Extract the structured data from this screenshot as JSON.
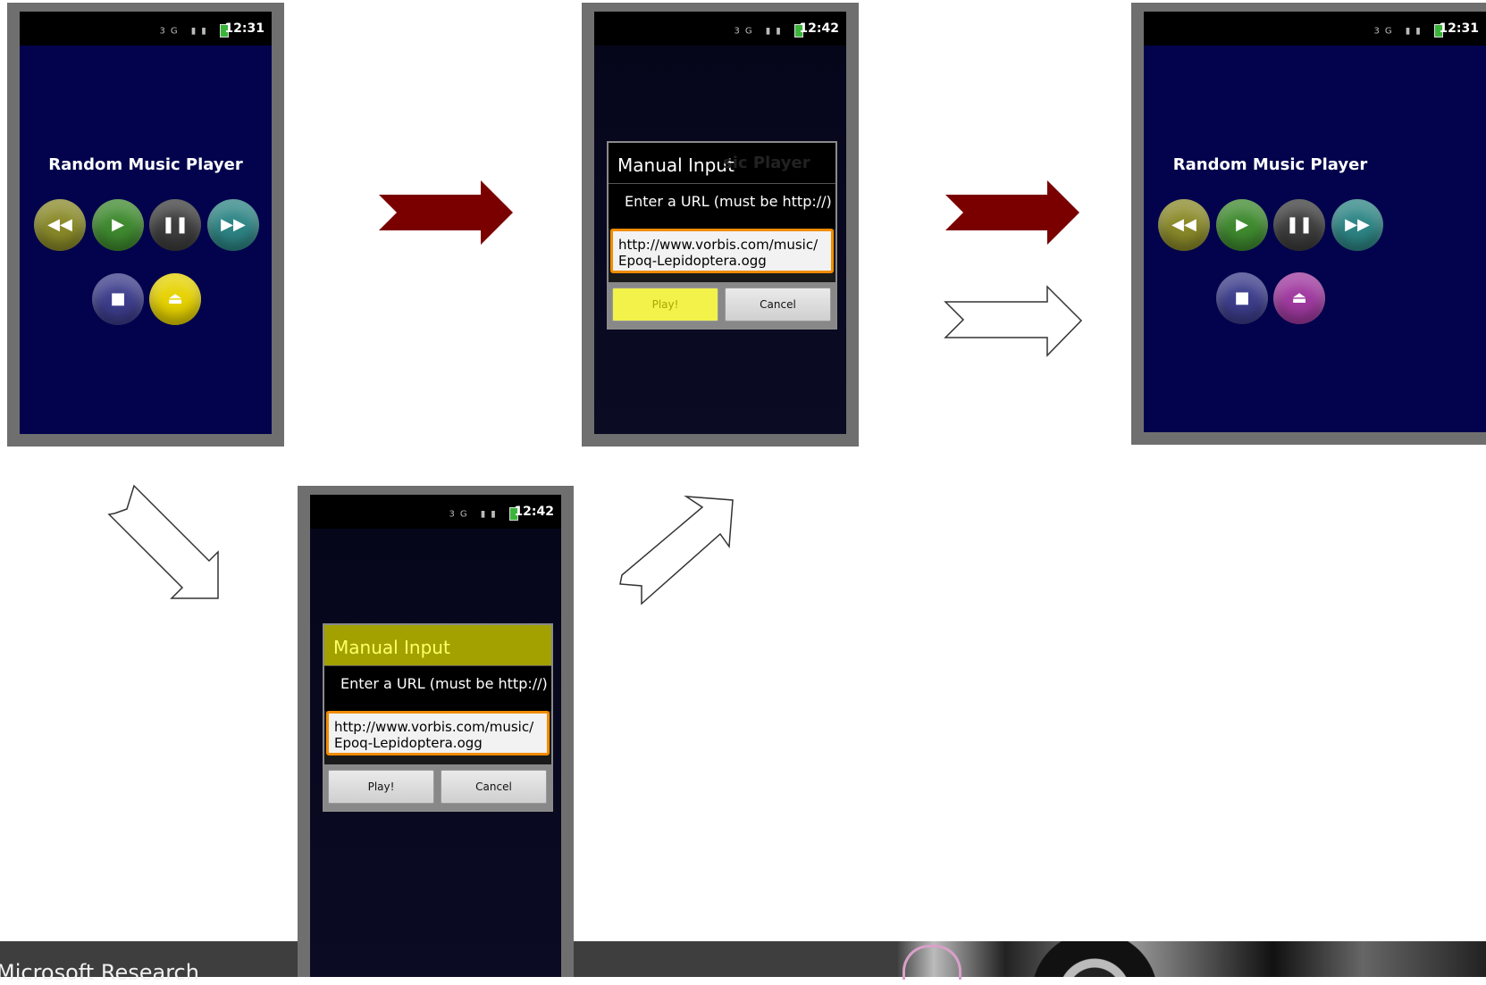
{
  "screens": {
    "initial": {
      "time": "12:31",
      "title": "Random Music Player",
      "buttons": [
        "rewind",
        "play",
        "pause",
        "fast-forward",
        "stop",
        "eject"
      ]
    },
    "dialog_play_selected": {
      "time": "12:42",
      "dialog_title": "Manual Input",
      "background_title_partial": "sic Player",
      "message": "Enter a URL (must be http://)",
      "url_value": "http://www.vorbis.com/music/Epoq-Lepidoptera.ogg",
      "url_line1": "http://www.vorbis.com/music/",
      "url_line2": "Epoq-Lepidoptera.ogg",
      "play_label": "Play!",
      "cancel_label": "Cancel"
    },
    "dialog_title_selected": {
      "time": "12:42",
      "dialog_title": "Manual Input",
      "message": "Enter a URL (must be http://)",
      "url_line1": "http://www.vorbis.com/music/",
      "url_line2": "Epoq-Lepidoptera.ogg",
      "play_label": "Play!",
      "cancel_label": "Cancel"
    },
    "final": {
      "time": "12:31",
      "title": "Random Music Player"
    }
  },
  "footer": {
    "brand": "Microsoft Research"
  },
  "colors": {
    "app_background": "#03034d",
    "arrow_red": "#7a0000",
    "rewind": "#8a8a2a",
    "play": "#3f8a2f",
    "pause": "#3d3d3d",
    "fast_forward": "#2e8585",
    "stop": "#3d3d8c",
    "eject_highlight": "#e6d200",
    "eject_final": "#a03aa0",
    "dialog_highlight": "#a2a100",
    "input_border": "#f08c00"
  },
  "icons": {
    "rewind": "rewind-icon",
    "play": "play-icon",
    "pause": "pause-icon",
    "fast_forward": "fast-forward-icon",
    "stop": "stop-icon",
    "eject": "eject-icon"
  }
}
